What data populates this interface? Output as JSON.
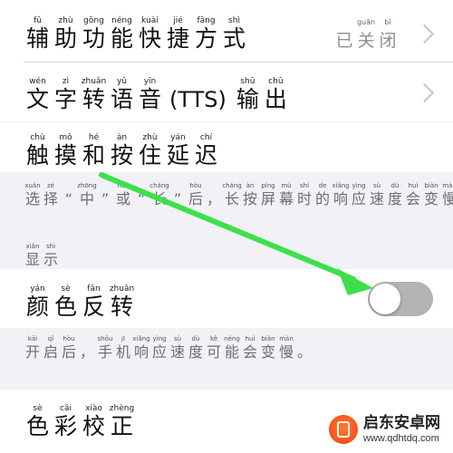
{
  "rows": [
    {
      "id": "shortcut",
      "label": [
        [
          "fǔ",
          "辅"
        ],
        [
          "zhù",
          "助"
        ],
        [
          "gōng",
          "功"
        ],
        [
          "néng",
          "能"
        ],
        [
          "kuài",
          "快"
        ],
        [
          "jié",
          "捷"
        ],
        [
          "fāng",
          "方"
        ],
        [
          "shì",
          "式"
        ]
      ],
      "value": [
        [
          "",
          "已"
        ],
        [
          "guān",
          "关"
        ],
        [
          "bì",
          "闭"
        ]
      ],
      "chevron": "chevron-right-icon"
    },
    {
      "id": "tts",
      "label_pre": [
        [
          "wén",
          "文"
        ],
        [
          "zì",
          "字"
        ],
        [
          "zhuǎn",
          "转"
        ],
        [
          "yǔ",
          "语"
        ],
        [
          "yīn",
          "音"
        ]
      ],
      "label_latin": "(TTS)",
      "label_post": [
        [
          "shū",
          "输"
        ],
        [
          "chū",
          "出"
        ]
      ],
      "chevron": "chevron-right-icon"
    },
    {
      "id": "touch-delay",
      "label": [
        [
          "chù",
          "触"
        ],
        [
          "mō",
          "摸"
        ],
        [
          "hé",
          "和"
        ],
        [
          "àn",
          "按"
        ],
        [
          "zhù",
          "住"
        ],
        [
          "yán",
          "延"
        ],
        [
          "chí",
          "迟"
        ]
      ]
    },
    {
      "id": "invert",
      "label": [
        [
          "yán",
          "颜"
        ],
        [
          "sè",
          "色"
        ],
        [
          "fǎn",
          "反"
        ],
        [
          "zhuǎn",
          "转"
        ]
      ],
      "toggle": {
        "on": false,
        "track_color": "#b3b3b3",
        "knob_color": "#ffffff"
      }
    },
    {
      "id": "color-correct",
      "label": [
        [
          "sè",
          "色"
        ],
        [
          "cǎi",
          "彩"
        ],
        [
          "xiào",
          "校"
        ],
        [
          "zhèng",
          "正"
        ]
      ]
    }
  ],
  "footnotes": {
    "touch": [
      [
        "xuǎn",
        "选"
      ],
      [
        "zé",
        "择"
      ],
      [
        "",
        "“"
      ],
      [
        "zhōng",
        "中"
      ],
      [
        "",
        "”"
      ],
      [
        "huò",
        "或"
      ],
      [
        "",
        "“"
      ],
      [
        "cháng",
        "长"
      ],
      [
        "",
        "”"
      ],
      [
        "hòu",
        "后"
      ],
      [
        "",
        "，"
      ],
      [
        "cháng",
        "长"
      ],
      [
        "àn",
        "按"
      ],
      [
        "píng",
        "屏"
      ],
      [
        "mù",
        "幕"
      ],
      [
        "shí",
        "时"
      ],
      [
        "de",
        "的"
      ],
      [
        "xiǎng",
        "响"
      ],
      [
        "yìng",
        "应"
      ],
      [
        "sù",
        "速"
      ],
      [
        "dù",
        "度"
      ],
      [
        "huì",
        "会"
      ],
      [
        "biàn",
        "变"
      ],
      [
        "màn",
        "慢"
      ],
      [
        "",
        "。"
      ]
    ],
    "invert": [
      [
        "kāi",
        "开"
      ],
      [
        "qǐ",
        "启"
      ],
      [
        "hòu",
        "后"
      ],
      [
        "",
        "，"
      ],
      [
        "shǒu",
        "手"
      ],
      [
        "jī",
        "机"
      ],
      [
        "xiǎng",
        "响"
      ],
      [
        "yìng",
        "应"
      ],
      [
        "sù",
        "速"
      ],
      [
        "dù",
        "度"
      ],
      [
        "kě",
        "可"
      ],
      [
        "néng",
        "能"
      ],
      [
        "huì",
        "会"
      ],
      [
        "biàn",
        "变"
      ],
      [
        "màn",
        "慢"
      ],
      [
        "",
        "。"
      ]
    ]
  },
  "section_header": [
    [
      "xiǎn",
      "显"
    ],
    [
      "shì",
      "示"
    ]
  ],
  "annotation": {
    "arrow_color": "#3ee04a",
    "icon": "arrow-annotation-icon"
  },
  "watermark": {
    "title": "启东安卓网",
    "url": "www.qdhtdq.com",
    "logo_icon": "brand-logo-icon"
  },
  "colors": {
    "background": "#f2f2f6",
    "cell": "#ffffff",
    "secondary_text": "#8e8e93"
  }
}
